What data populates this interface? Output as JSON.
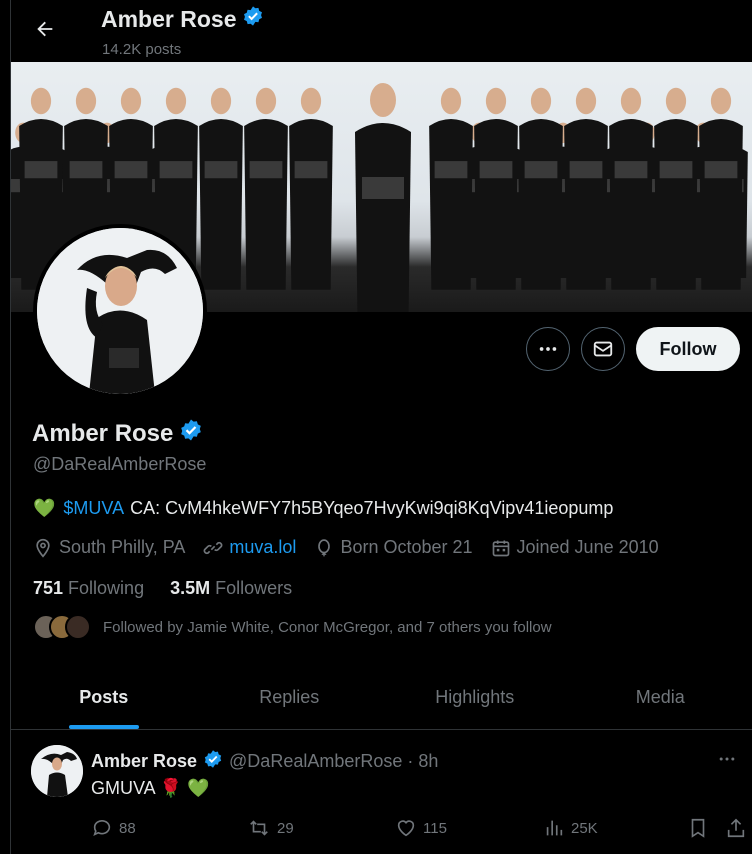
{
  "header": {
    "back_icon": "arrow-left-icon",
    "name": "Amber Rose",
    "post_count": "14.2K posts"
  },
  "profile": {
    "name": "Amber Rose",
    "handle": "@DaRealAmberRose",
    "bio": {
      "emoji": "💚",
      "link": "$MUVA",
      "text": "CA: CvM4hkeWFY7h5BYqeo7HvyKwi9qi8KqVipv41ieopump"
    },
    "meta": {
      "location": "South Philly, PA",
      "website": "muva.lol",
      "birthday": "Born October 21",
      "joined": "Joined June 2010"
    },
    "following_count": "751",
    "following_label": "Following",
    "followers_count": "3.5M",
    "followers_label": "Followers",
    "followed_by": "Followed by Jamie White, Conor McGregor, and 7 others you follow"
  },
  "buttons": {
    "follow": "Follow",
    "more_icon": "more-horizontal-icon",
    "message_icon": "envelope-icon"
  },
  "tabs": [
    "Posts",
    "Replies",
    "Highlights",
    "Media"
  ],
  "tweet": {
    "name": "Amber Rose",
    "handle_time": "@DaRealAmberRose · 8h",
    "text": "GMUVA 🌹 💚",
    "replies": "88",
    "reposts": "29",
    "likes": "115",
    "views": "25K"
  },
  "colors": {
    "accent": "#1d9bf0",
    "background": "#000000",
    "muted": "#71767b"
  }
}
